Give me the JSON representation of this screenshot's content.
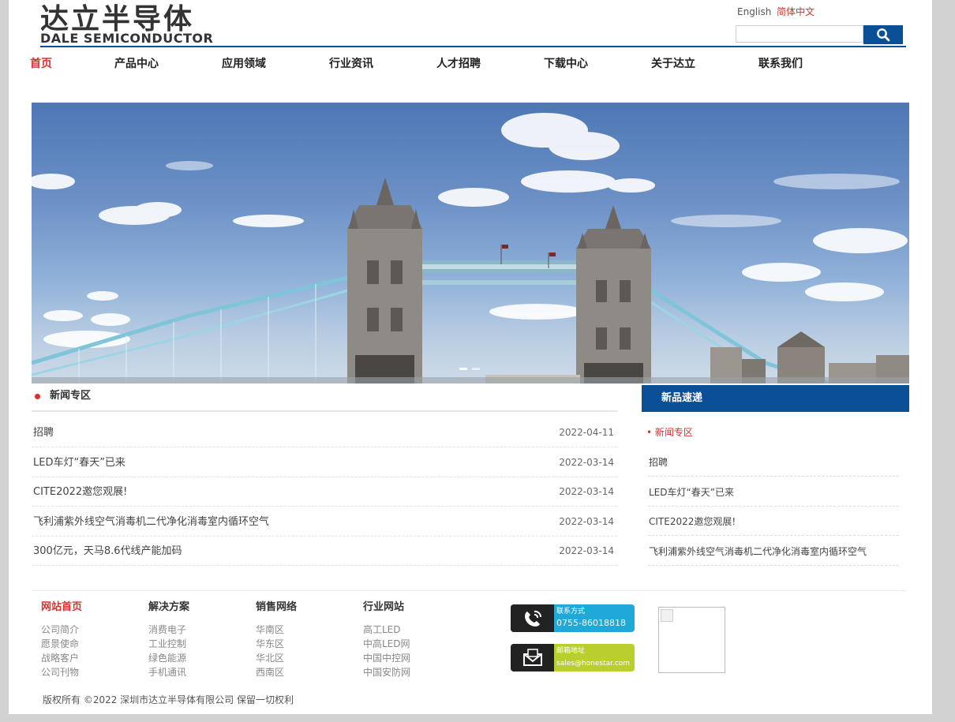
{
  "header": {
    "logo_cn": "达立半导体",
    "logo_en": "DALE SEMICONDUCTOR",
    "lang_english": "English",
    "lang_chinese": "简体中文",
    "search_placeholder": ""
  },
  "nav": {
    "items": [
      "首页",
      "产品中心",
      "应用领域",
      "行业资讯",
      "人才招聘",
      "下载中心",
      "关于达立",
      "联系我们"
    ],
    "active_index": 0
  },
  "banner": {
    "slides": 2,
    "active_slide": 1
  },
  "news": {
    "title": "新闻专区",
    "items": [
      {
        "title": "招聘",
        "date": "2022-04-11"
      },
      {
        "title": "LED车灯“春天”已来",
        "date": "2022-03-14"
      },
      {
        "title": "CITE2022邀您观展!",
        "date": "2022-03-14"
      },
      {
        "title": "飞利浦紫外线空气消毒机二代净化消毒室内循环空气",
        "date": "2022-03-14"
      },
      {
        "title": "300亿元，天马8.6代线产能加码",
        "date": "2022-03-14"
      }
    ]
  },
  "new_products": {
    "title": "新品速递",
    "subtitle": "• 新闻专区",
    "items": [
      "招聘",
      "LED车灯“春天”已来",
      "CITE2022邀您观展!",
      "飞利浦紫外线空气消毒机二代净化消毒室内循环空气"
    ]
  },
  "footer": {
    "columns": [
      {
        "heading": "网站首页",
        "links": [
          "公司简介",
          "愿景使命",
          "战略客户",
          "公司刊物"
        ]
      },
      {
        "heading": "解决方案",
        "links": [
          "消费电子",
          "工业控制",
          "绿色能源",
          "手机通讯"
        ]
      },
      {
        "heading": "销售网络",
        "links": [
          "华南区",
          "华东区",
          "华北区",
          "西南区"
        ]
      },
      {
        "heading": "行业网站",
        "links": [
          "高工LED",
          "中高LED网",
          "中国中控网",
          "中国安防网"
        ]
      }
    ],
    "contact": {
      "label": "联系方式",
      "value": "0755-86018818"
    },
    "email": {
      "label": "邮箱地址",
      "value": "sales@honestar.com"
    },
    "copyright": "版权所有 ©2022 深圳市达立半导体有限公司 保留一切权利"
  },
  "colors": {
    "brand_blue": "#0b4f97",
    "accent_red": "#d9302c",
    "phone_badge": "#1ea9d8",
    "mail_badge": "#b9cf2e"
  },
  "icons": [
    "search-icon",
    "phone-icon",
    "mail-icon",
    "broken-image-icon"
  ]
}
